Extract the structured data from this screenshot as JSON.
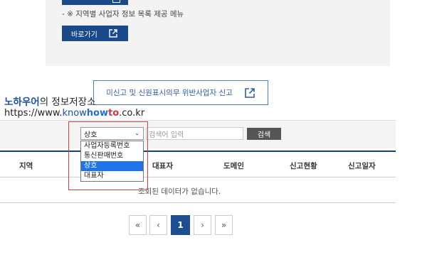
{
  "top_section": {
    "note": "- ※ 지역별 사업자 정보 목록 제공 메뉴",
    "go_button_label": "바로가기",
    "go_button_icon": "external-link-icon"
  },
  "report_button": {
    "label": "미신고 및 신원표시의무 위반사업자 신고",
    "icon": "external-link-icon"
  },
  "watermark": {
    "brand": "노하우어",
    "rest": "의 정보저장소",
    "url_prefix": "https://www.",
    "url_know": "know",
    "url_how": "how",
    "url_to": "to",
    "url_suffix": ".co.kr"
  },
  "search": {
    "select_value": "상호",
    "input_placeholder": "검색어 입력",
    "button_label": "검색",
    "options": [
      "사업자등록번호",
      "통신판매번호",
      "상호",
      "대표자"
    ],
    "selected_index": 2
  },
  "table": {
    "columns": [
      "지역",
      "대표자",
      "도메인",
      "신고현황",
      "신고일자"
    ],
    "empty_message": "조회된 데이터가 없습니다."
  },
  "pagination": {
    "first": "«",
    "prev": "‹",
    "current": "1",
    "next": "›",
    "last": "»"
  },
  "colors": {
    "primary_dark": "#1b4f91",
    "highlight_red": "#e03a3a",
    "option_selected": "#1e73e8"
  }
}
